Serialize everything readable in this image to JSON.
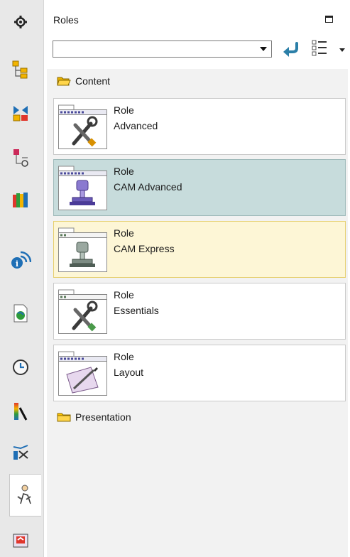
{
  "panel": {
    "title": "Roles"
  },
  "toolbar": {
    "combo_value": ""
  },
  "folders": [
    {
      "label": "Content",
      "state": "open"
    },
    {
      "label": "Presentation",
      "state": "closed"
    }
  ],
  "roles": [
    {
      "type": "Role",
      "name": "Advanced",
      "state": "normal",
      "icon": "tools-icon"
    },
    {
      "type": "Role",
      "name": "CAM Advanced",
      "state": "selected",
      "icon": "machine-icon"
    },
    {
      "type": "Role",
      "name": "CAM Express",
      "state": "hover",
      "icon": "machine-icon"
    },
    {
      "type": "Role",
      "name": "Essentials",
      "state": "normal",
      "icon": "tools-icon"
    },
    {
      "type": "Role",
      "name": "Layout",
      "state": "normal",
      "icon": "layout-pen-icon"
    }
  ],
  "resource_bar": [
    "settings-gear-icon",
    "assembly-navigator-icon",
    "constraint-navigator-icon",
    "part-navigator-icon",
    "reuse-library-icon",
    "information-icon",
    "web-browser-icon",
    "history-icon",
    "visualization-icon",
    "analysis-icon",
    "roles-icon",
    "system-materials-icon"
  ],
  "colors": {
    "selected_bg": "#c7dcdc",
    "hover_bg": "#fdf6d6",
    "hover_border": "#e6cf6e",
    "back_arrow": "#2b7fa8"
  }
}
